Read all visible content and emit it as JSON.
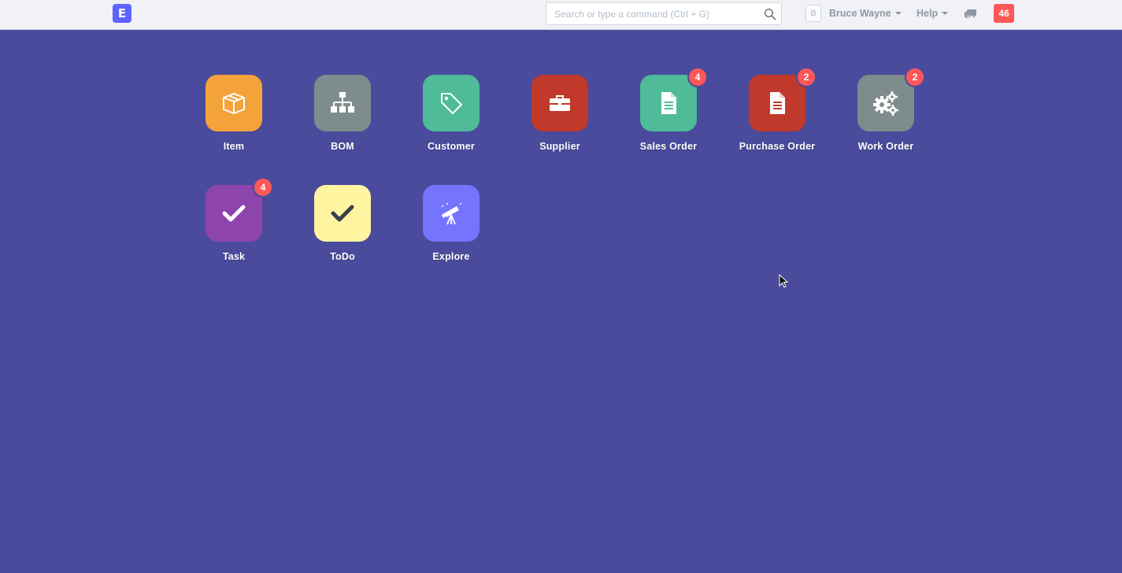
{
  "navbar": {
    "logo_letter": "E",
    "search_placeholder": "Search or type a command (Ctrl + G)",
    "avatar_letter": "B",
    "user_name": "Bruce Wayne",
    "help_label": "Help",
    "notification_count": "46"
  },
  "modules": [
    {
      "label": "Item",
      "color": "#f4a23a",
      "icon": "box-icon",
      "badge": ""
    },
    {
      "label": "BOM",
      "color": "#7f8c8d",
      "icon": "sitemap-icon",
      "badge": ""
    },
    {
      "label": "Customer",
      "color": "#4fbb99",
      "icon": "tag-icon",
      "badge": ""
    },
    {
      "label": "Supplier",
      "color": "#c0392b",
      "icon": "briefcase-icon",
      "badge": ""
    },
    {
      "label": "Sales Order",
      "color": "#4fbb99",
      "icon": "file-text-icon",
      "badge": "4"
    },
    {
      "label": "Purchase Order",
      "color": "#c0392b",
      "icon": "file-text-icon",
      "badge": "2"
    },
    {
      "label": "Work Order",
      "color": "#7f8c8d",
      "icon": "gears-icon",
      "badge": "2"
    },
    {
      "label": "Task",
      "color": "#8e44ad",
      "icon": "check-icon",
      "badge": "4"
    },
    {
      "label": "ToDo",
      "color": "#fff5a0",
      "icon": "check-icon",
      "badge": ""
    },
    {
      "label": "Explore",
      "color": "#7574ff",
      "icon": "telescope-icon",
      "badge": ""
    }
  ]
}
